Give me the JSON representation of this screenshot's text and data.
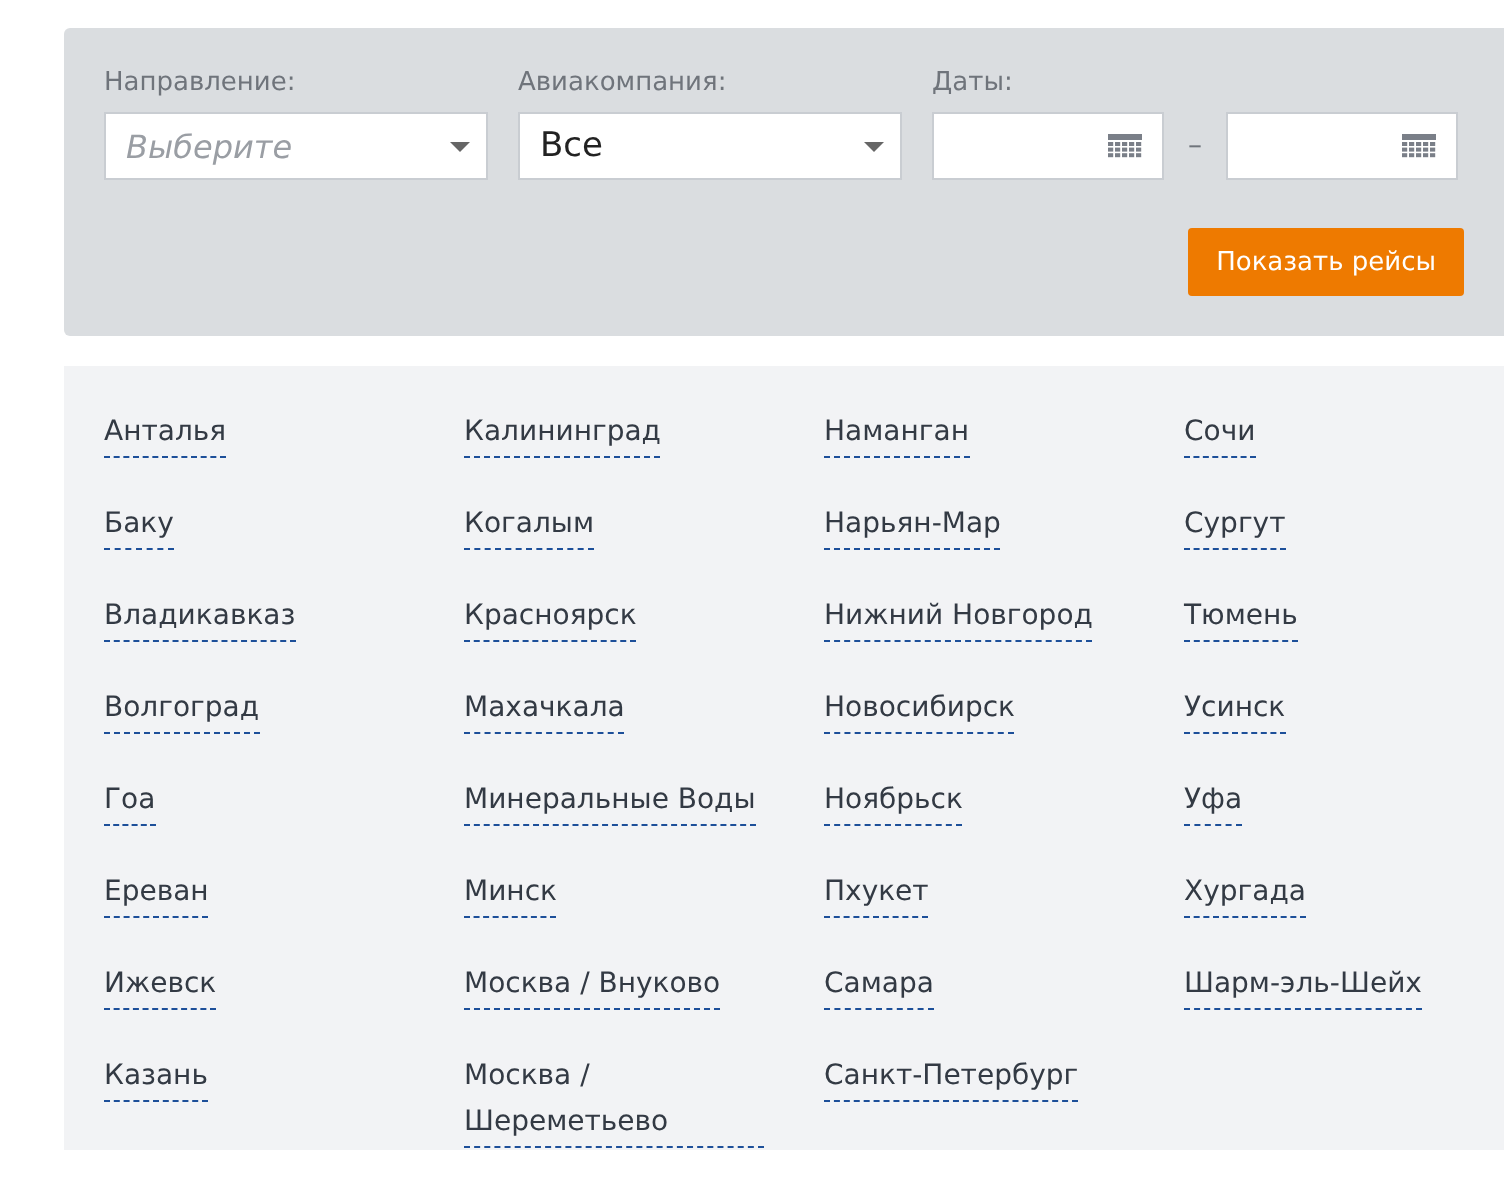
{
  "filters": {
    "direction": {
      "label": "Направление:",
      "placeholder": "Выберите"
    },
    "airline": {
      "label": "Авиакомпания:",
      "value": "Все"
    },
    "dates": {
      "label": "Даты:",
      "separator": "–"
    },
    "submit": "Показать рейсы"
  },
  "cities": [
    [
      "Анталья",
      "Баку",
      "Владикавказ",
      "Волгоград",
      "Гоа",
      "Ереван",
      "Ижевск",
      "Казань"
    ],
    [
      "Калининград",
      "Когалым",
      "Красноярск",
      "Махачкала",
      "Минеральные Воды",
      "Минск",
      "Москва / Внуково",
      "Москва / Шереметьево"
    ],
    [
      "Наманган",
      "Нарьян-Мар",
      "Нижний Новгород",
      "Новосибирск",
      "Ноябрьск",
      "Пхукет",
      "Самара",
      "Санкт-Петербург"
    ],
    [
      "Сочи",
      "Сургут",
      "Тюмень",
      "Усинск",
      "Уфа",
      "Хургада",
      "Шарм-эль-Шейх"
    ]
  ]
}
